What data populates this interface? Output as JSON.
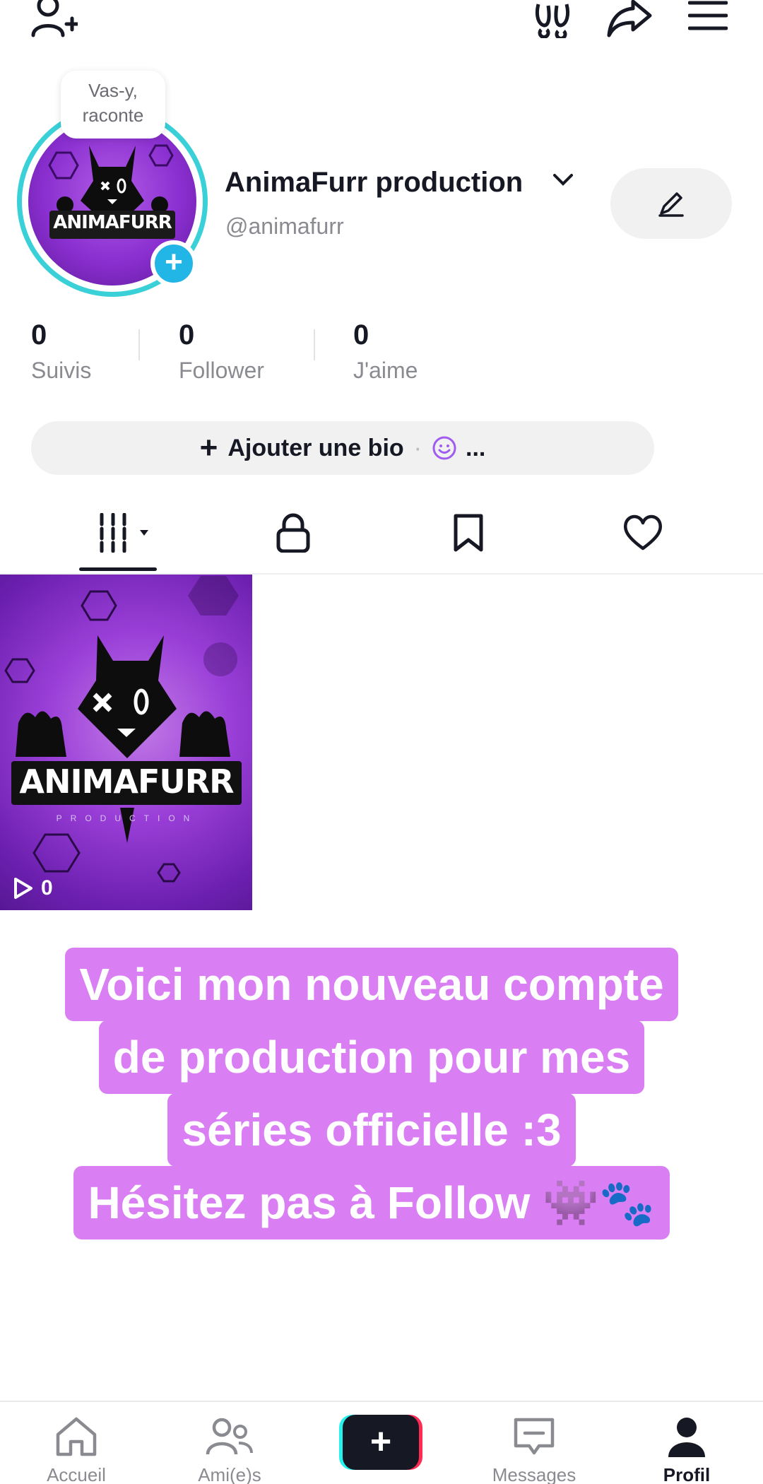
{
  "profile": {
    "story_prompt_line1": "Vas-y,",
    "story_prompt_line2": "raconte",
    "display_name": "AnimaFurr production",
    "username": "@animafurr",
    "avatar_logo_text": "ANIMAFURR"
  },
  "stats": {
    "following_count": "0",
    "following_label": "Suivis",
    "followers_count": "0",
    "followers_label": "Follower",
    "likes_count": "0",
    "likes_label": "J'aime"
  },
  "bio": {
    "add_label": "Ajouter une bio",
    "more": "..."
  },
  "video": {
    "logo_text": "ANIMAFURR",
    "logo_subtitle": "PRODUCTION",
    "play_count": "0"
  },
  "caption": {
    "line1": "Voici mon nouveau compte",
    "line2": "de production pour mes",
    "line3": "séries officielle :3",
    "line4": "Hésitez pas à Follow 👾🐾"
  },
  "nav": {
    "home": "Accueil",
    "friends": "Ami(e)s",
    "create": "+",
    "messages": "Messages",
    "profile": "Profil"
  },
  "colors": {
    "ring": "#3ad0d8",
    "caption_bg": "#d97ff3",
    "plus_badge": "#22b6e6",
    "brand_cyan": "#25f4ee",
    "brand_red": "#fe2c55"
  }
}
